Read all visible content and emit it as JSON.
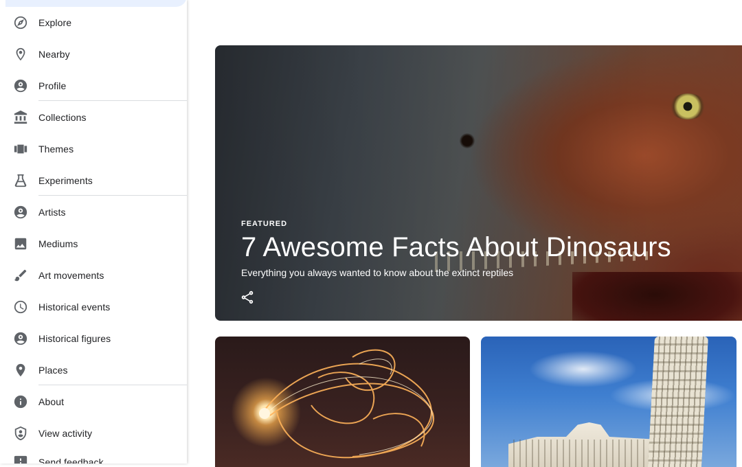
{
  "sidebar": {
    "items": [
      {
        "label": "Explore",
        "icon": "compass-icon"
      },
      {
        "label": "Nearby",
        "icon": "location-pin-icon"
      },
      {
        "label": "Profile",
        "icon": "account-circle-icon"
      },
      {
        "label": "Collections",
        "icon": "museum-icon"
      },
      {
        "label": "Themes",
        "icon": "view-carousel-icon"
      },
      {
        "label": "Experiments",
        "icon": "flask-icon"
      },
      {
        "label": "Artists",
        "icon": "account-circle-icon"
      },
      {
        "label": "Mediums",
        "icon": "image-icon"
      },
      {
        "label": "Art movements",
        "icon": "brush-icon"
      },
      {
        "label": "Historical events",
        "icon": "clock-icon"
      },
      {
        "label": "Historical figures",
        "icon": "account-circle-icon"
      },
      {
        "label": "Places",
        "icon": "place-icon"
      },
      {
        "label": "About",
        "icon": "info-icon"
      },
      {
        "label": "View activity",
        "icon": "shield-account-icon"
      },
      {
        "label": "Send feedback",
        "icon": "feedback-icon"
      }
    ]
  },
  "featured": {
    "eyebrow": "FEATURED",
    "title": "7 Awesome Facts About Dinosaurs",
    "subtitle": "Everything you always wanted to know about the extinct reptiles",
    "share_icon": "share-icon"
  },
  "colors": {
    "active_background": "#e8f0fe",
    "icon_gray": "#5f6368",
    "text": "#202124",
    "divider": "#dadce0"
  }
}
